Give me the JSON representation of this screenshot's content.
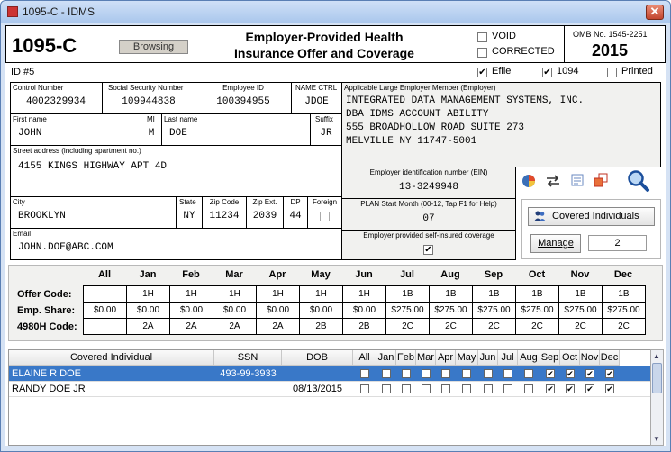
{
  "window": {
    "title": "1095-C - IDMS"
  },
  "header": {
    "form_code": "1095-C",
    "browsing_label": "Browsing",
    "title_line1": "Employer-Provided Health",
    "title_line2": "Insurance Offer and Coverage",
    "void_label": "VOID",
    "corrected_label": "CORRECTED",
    "omb": "OMB No. 1545-2251",
    "year": "2015"
  },
  "idbar": {
    "id_label": "ID #5",
    "efile_label": "Efile",
    "efile_checked": true,
    "f1094_label": "1094",
    "f1094_checked": true,
    "printed_label": "Printed",
    "printed_checked": false
  },
  "employee": {
    "control_label": "Control Number",
    "control": "4002329934",
    "ssn_label": "Social Security Number",
    "ssn": "109944838",
    "empid_label": "Employee ID",
    "empid": "100394955",
    "namectrl_label": "NAME CTRL",
    "namectrl": "JDOE",
    "first_label": "First name",
    "first": "JOHN",
    "mi_label": "MI",
    "mi": "M",
    "last_label": "Last name",
    "last": "DOE",
    "suffix_label": "Suffix",
    "suffix": "JR",
    "street_label": "Street address (including apartment no.)",
    "street": "4155 KINGS HIGHWAY APT 4D",
    "city_label": "City",
    "city": "BROOKLYN",
    "state_label": "State",
    "state": "NY",
    "zip_label": "Zip Code",
    "zip": "11234",
    "zipext_label": "Zip Ext.",
    "zipext": "2039",
    "dp_label": "DP",
    "dp": "44",
    "foreign_label": "Foreign",
    "email_label": "Email",
    "email": "JOHN.DOE@ABC.COM"
  },
  "employer": {
    "ale_label": "Applicable Large Employer Member (Employer)",
    "line1": "INTEGRATED DATA MANAGEMENT SYSTEMS, INC.",
    "line2": "DBA IDMS ACCOUNT ABILITY",
    "line3": "555 BROADHOLLOW ROAD SUITE 273",
    "line4": "MELVILLE NY 11747-5001",
    "ein_label": "Employer identification number (EIN)",
    "ein": "13-3249948",
    "plan_label": "PLAN Start Month (00-12, Tap F1 for Help)",
    "plan": "07",
    "selfins_label": "Employer provided self-insured coverage",
    "selfins_checked": true,
    "covered_btn": "Covered Individuals",
    "manage_btn": "Manage",
    "count": "2"
  },
  "months": [
    "All",
    "Jan",
    "Feb",
    "Mar",
    "Apr",
    "May",
    "Jun",
    "Jul",
    "Aug",
    "Sep",
    "Oct",
    "Nov",
    "Dec"
  ],
  "rows": {
    "offer_label": "Offer Code:",
    "offer": [
      "",
      "1H",
      "1H",
      "1H",
      "1H",
      "1H",
      "1H",
      "1B",
      "1B",
      "1B",
      "1B",
      "1B",
      "1B"
    ],
    "share_label": "Emp. Share:",
    "share": [
      "$0.00",
      "$0.00",
      "$0.00",
      "$0.00",
      "$0.00",
      "$0.00",
      "$0.00",
      "$275.00",
      "$275.00",
      "$275.00",
      "$275.00",
      "$275.00",
      "$275.00"
    ],
    "h4980_label": "4980H Code:",
    "h4980": [
      "",
      "2A",
      "2A",
      "2A",
      "2A",
      "2B",
      "2B",
      "2C",
      "2C",
      "2C",
      "2C",
      "2C",
      "2C"
    ]
  },
  "covered_table": {
    "headers": [
      "Covered Individual",
      "SSN",
      "DOB",
      "All",
      "Jan",
      "Feb",
      "Mar",
      "Apr",
      "May",
      "Jun",
      "Jul",
      "Aug",
      "Sep",
      "Oct",
      "Nov",
      "Dec"
    ],
    "rows": [
      {
        "name": "ELAINE R DOE",
        "ssn": "493-99-3933",
        "dob": "",
        "checks": [
          false,
          false,
          false,
          false,
          false,
          false,
          false,
          false,
          false,
          true,
          true,
          true,
          true
        ],
        "selected": true
      },
      {
        "name": "RANDY DOE JR",
        "ssn": "",
        "dob": "08/13/2015",
        "checks": [
          false,
          false,
          false,
          false,
          false,
          false,
          false,
          false,
          false,
          true,
          true,
          true,
          true
        ],
        "selected": false
      }
    ]
  }
}
